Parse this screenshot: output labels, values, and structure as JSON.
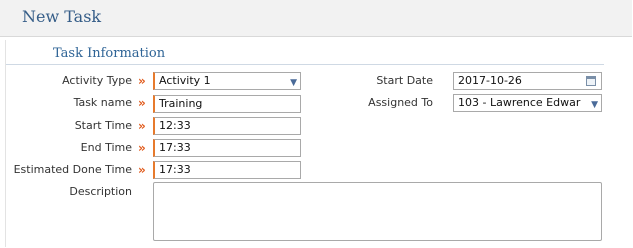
{
  "header": {
    "title": "New Task"
  },
  "section": {
    "title": "Task Information"
  },
  "required_marker": "»",
  "form": {
    "activity_type": {
      "label": "Activity Type",
      "value": "Activity 1"
    },
    "task_name": {
      "label": "Task name",
      "value": "Training"
    },
    "start_time": {
      "label": "Start Time",
      "value": "12:33"
    },
    "end_time": {
      "label": "End Time",
      "value": "17:33"
    },
    "estimated_done_time": {
      "label": "Estimated Done Time",
      "value": "17:33"
    },
    "description": {
      "label": "Description",
      "value": ""
    },
    "start_date": {
      "label": "Start Date",
      "value": "2017-10-26"
    },
    "assigned_to": {
      "label": "Assigned To",
      "value": "103 - Lawrence Edwar"
    }
  },
  "icons": {
    "dropdown": "chevron-down-icon",
    "calendar": "calendar-icon"
  },
  "colors": {
    "title": "#355d88",
    "section_title": "#2f6496",
    "required": "#e15b1c",
    "accent_border": "#e77a2c"
  }
}
